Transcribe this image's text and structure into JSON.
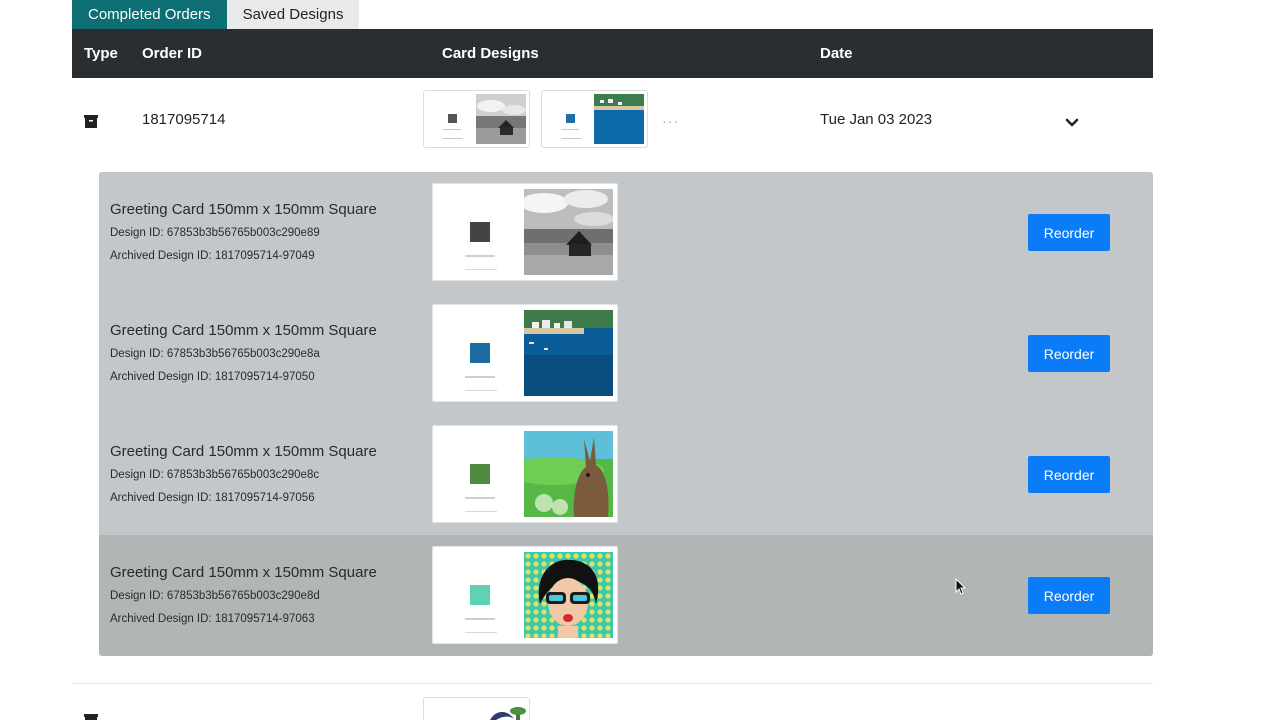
{
  "tabs": [
    {
      "label": "Completed Orders",
      "active": true
    },
    {
      "label": "Saved Designs",
      "active": false
    }
  ],
  "table_header": {
    "type": "Type",
    "order_id": "Order ID",
    "card_designs": "Card Designs",
    "date": "Date"
  },
  "order": {
    "type_icon": "archive-box-icon",
    "order_id": "1817095714",
    "date": "Tue Jan 03 2023",
    "more_indicator": "···",
    "expand_icon": "chevron-down-icon"
  },
  "items": [
    {
      "title": "Greeting Card 150mm x 150mm Square",
      "design_id": "Design ID: 67853b3b56765b003c290e89",
      "archived_id": "Archived Design ID: 1817095714-97049",
      "image": "black-and-white-barn-landscape",
      "reorder_label": "Reorder"
    },
    {
      "title": "Greeting Card 150mm x 150mm Square",
      "design_id": "Design ID: 67853b3b56765b003c290e8a",
      "archived_id": "Archived Design ID: 1817095714-97050",
      "image": "coastal-village-sea",
      "reorder_label": "Reorder"
    },
    {
      "title": "Greeting Card 150mm x 150mm Square",
      "design_id": "Design ID: 67853b3b56765b003c290e8c",
      "archived_id": "Archived Design ID: 1817095714-97056",
      "image": "hare-green-field",
      "reorder_label": "Reorder"
    },
    {
      "title": "Greeting Card 150mm x 150mm Square",
      "design_id": "Design ID: 67853b3b56765b003c290e8d",
      "archived_id": "Archived Design ID: 1817095714-97063",
      "image": "pop-art-woman-sunglasses",
      "reorder_label": "Reorder"
    }
  ],
  "colors": {
    "tab_active": "#0d6e73",
    "header_bg": "#2b2e31",
    "expanded_bg": "#c3c7ca",
    "reorder_button": "#0a7cf7"
  }
}
